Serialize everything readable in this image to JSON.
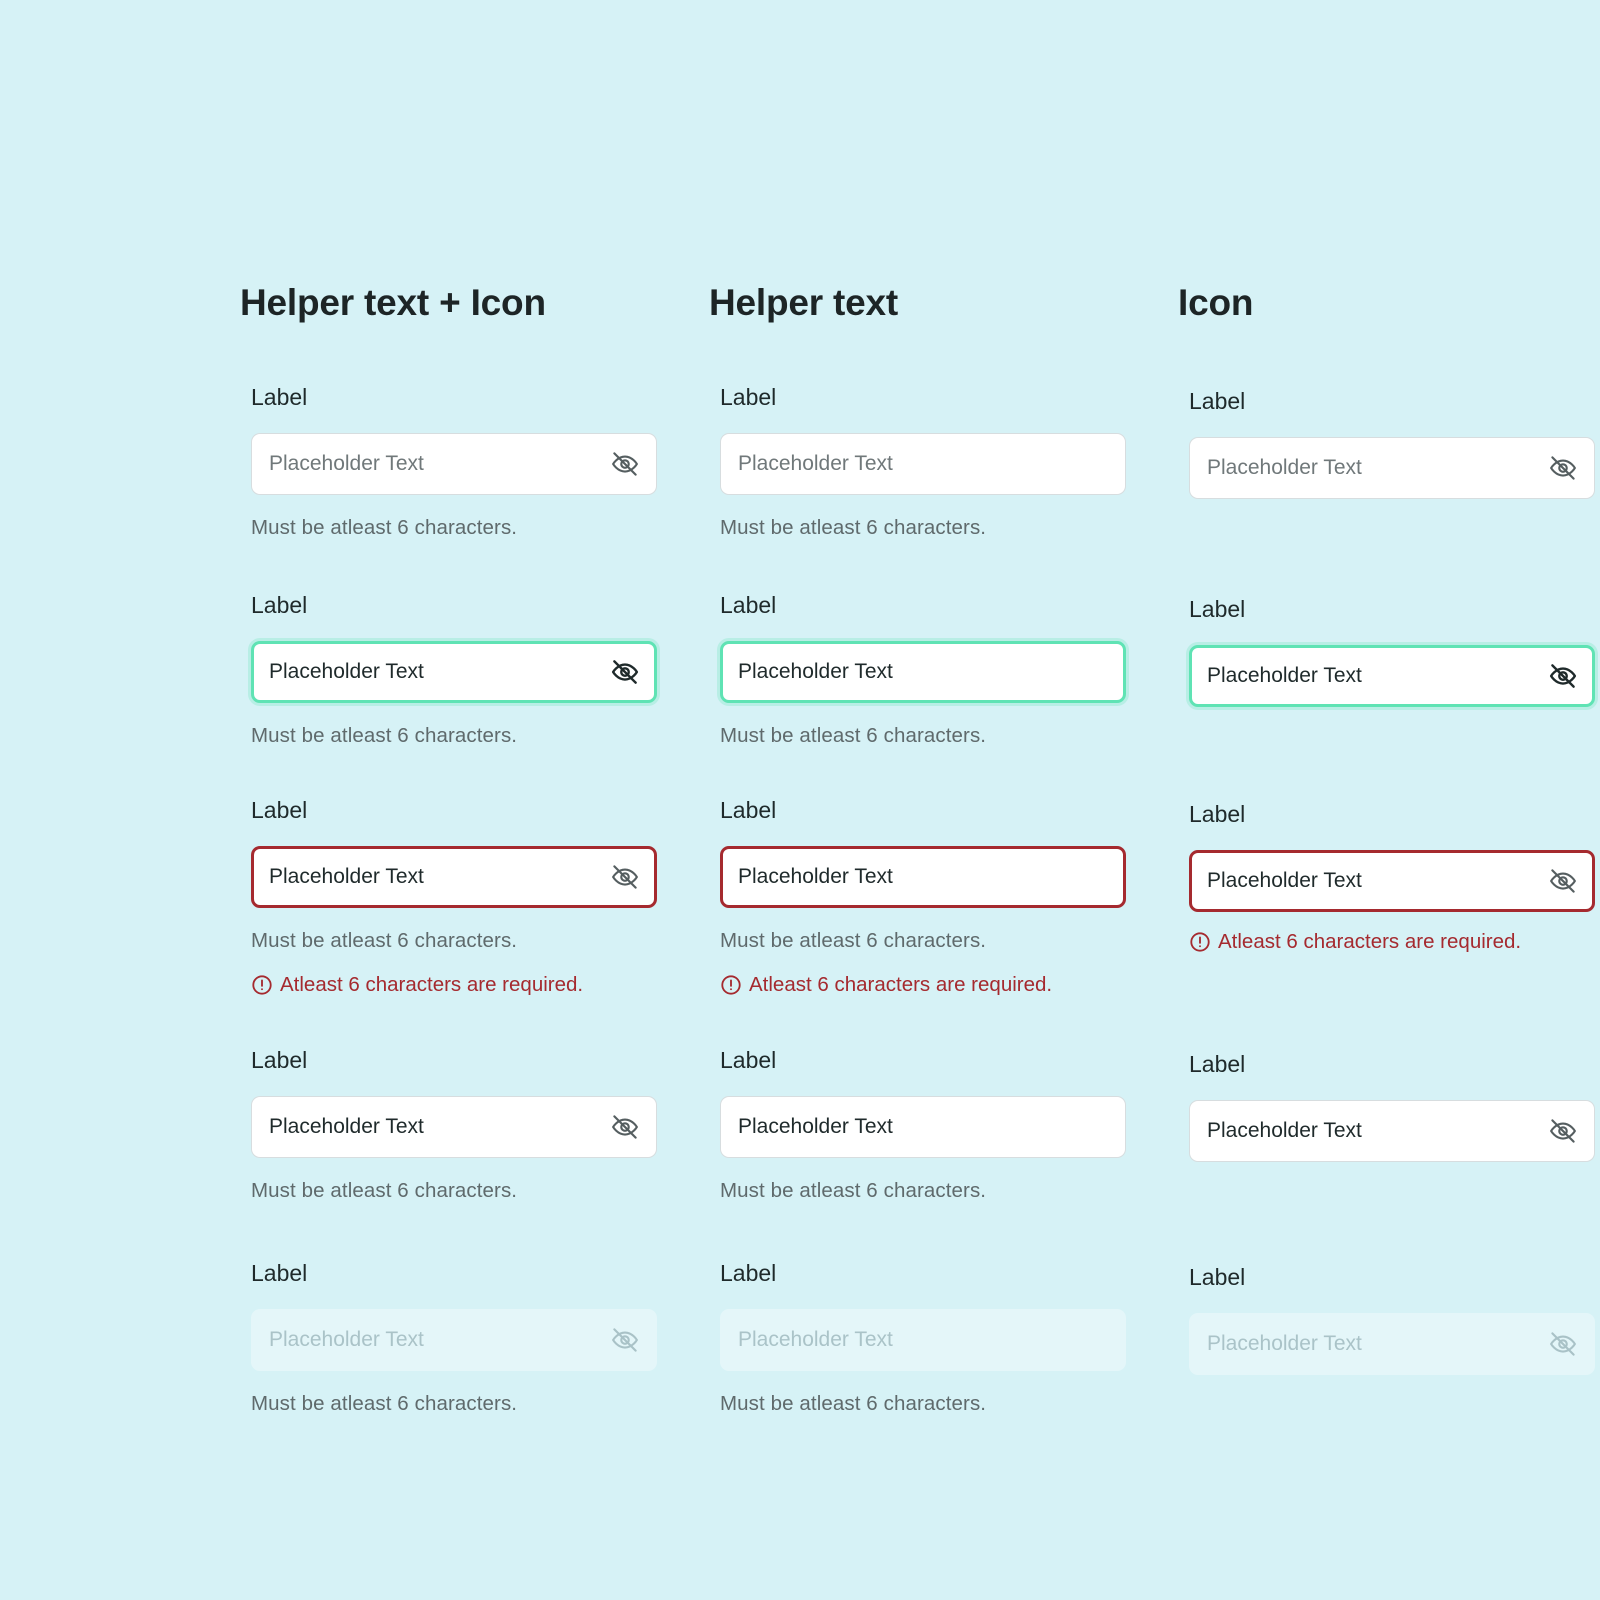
{
  "columns": [
    {
      "title": "Helper text + Icon",
      "fields": [
        {
          "label": "Label",
          "value": "Placeholder Text",
          "helper": "Must be atleast 6 characters."
        },
        {
          "label": "Label",
          "value": "Placeholder Text",
          "helper": "Must be atleast 6 characters."
        },
        {
          "label": "Label",
          "value": "Placeholder Text",
          "helper": "Must be atleast 6 characters.",
          "error": "Atleast 6 characters are required."
        },
        {
          "label": "Label",
          "value": "Placeholder Text",
          "helper": "Must be atleast 6 characters."
        },
        {
          "label": "Label",
          "value": "Placeholder Text",
          "helper": "Must be atleast 6 characters."
        }
      ]
    },
    {
      "title": "Helper text",
      "fields": [
        {
          "label": "Label",
          "value": "Placeholder Text",
          "helper": "Must be atleast 6 characters."
        },
        {
          "label": "Label",
          "value": "Placeholder Text",
          "helper": "Must be atleast 6 characters."
        },
        {
          "label": "Label",
          "value": "Placeholder Text",
          "helper": "Must be atleast 6 characters.",
          "error": "Atleast 6 characters are required."
        },
        {
          "label": "Label",
          "value": "Placeholder Text",
          "helper": "Must be atleast 6 characters."
        },
        {
          "label": "Label",
          "value": "Placeholder Text",
          "helper": "Must be atleast 6 characters."
        }
      ]
    },
    {
      "title": "Icon",
      "fields": [
        {
          "label": "Label",
          "value": "Placeholder Text"
        },
        {
          "label": "Label",
          "value": "Placeholder Text"
        },
        {
          "label": "Label",
          "value": "Placeholder Text",
          "error": "Atleast 6 characters are required."
        },
        {
          "label": "Label",
          "value": "Placeholder Text"
        },
        {
          "label": "Label",
          "value": "Placeholder Text"
        }
      ]
    }
  ],
  "states": [
    "default",
    "focused",
    "error",
    "filled",
    "disabled"
  ],
  "colors": {
    "background": "#d6f2f6",
    "focus_border": "#5fe3b4",
    "error": "#a52a2f",
    "disabled_fill": "#e4f6f9"
  },
  "icons": {
    "input_icon": "eye-off-icon",
    "error_icon": "alert-circle-icon"
  }
}
